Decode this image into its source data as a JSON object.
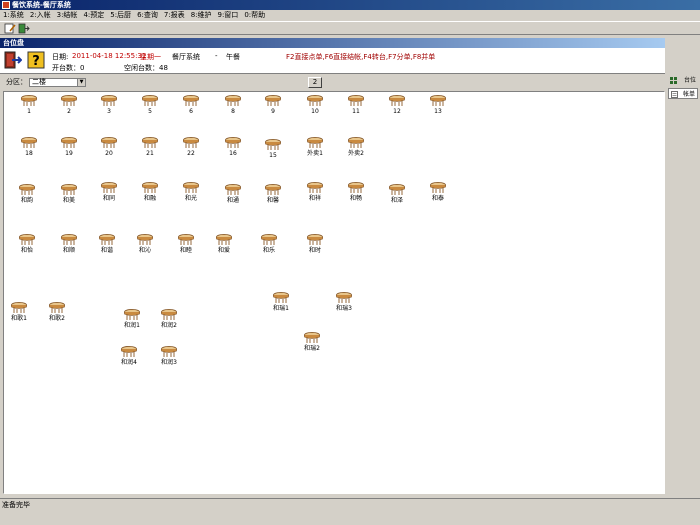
{
  "window": {
    "title": "餐饮系统-餐厅系统"
  },
  "menu": [
    "1:系统",
    "2:入帐",
    "3:结帐",
    "4:预定",
    "5:后厨",
    "6:查询",
    "7:报表",
    "8:维护",
    "9:窗口",
    "0:帮助"
  ],
  "panel": {
    "title": "台位盘"
  },
  "info": {
    "date_label": "日期:",
    "date_value": "2011-04-18 12:55:31",
    "weekday": "星期一",
    "system_label": "餐厅系统",
    "dash": "-",
    "meal": "午餐",
    "shortcuts": "F2直接点单,F6直接结帐,F4转台,F7分单,F8并单",
    "open_tables": "开台数：0",
    "free_tables": "空闲台数：48"
  },
  "filter": {
    "label": "分区：",
    "selected": "二楼",
    "next_label": "2"
  },
  "sidebar": {
    "tab_tables": "台位",
    "tab_bill": "帐单"
  },
  "tables": [
    "1",
    "2",
    "3",
    "5",
    "6",
    "8",
    "9",
    "10",
    "11",
    "12",
    "13",
    "18",
    "19",
    "20",
    "21",
    "22",
    "16",
    "15",
    "外卖1",
    "外卖2",
    "和韵",
    "和美",
    "和同",
    "和融",
    "和光",
    "和通",
    "和馨",
    "和祥",
    "和畅",
    "和泽",
    "和泰",
    "和怡",
    "和顺",
    "和谐",
    "和沁",
    "和睦",
    "和爱",
    "和乐",
    "和时",
    "和歌1",
    "和歌2",
    "和润1",
    "和润2",
    "和润4",
    "和润3",
    "和瑞1",
    "和瑞3",
    "和瑞2"
  ],
  "status": {
    "text": "准备完毕"
  },
  "colors": {
    "title_bar": "#0a246a",
    "table_top": "#e8c58a",
    "info_red": "#c00000"
  }
}
